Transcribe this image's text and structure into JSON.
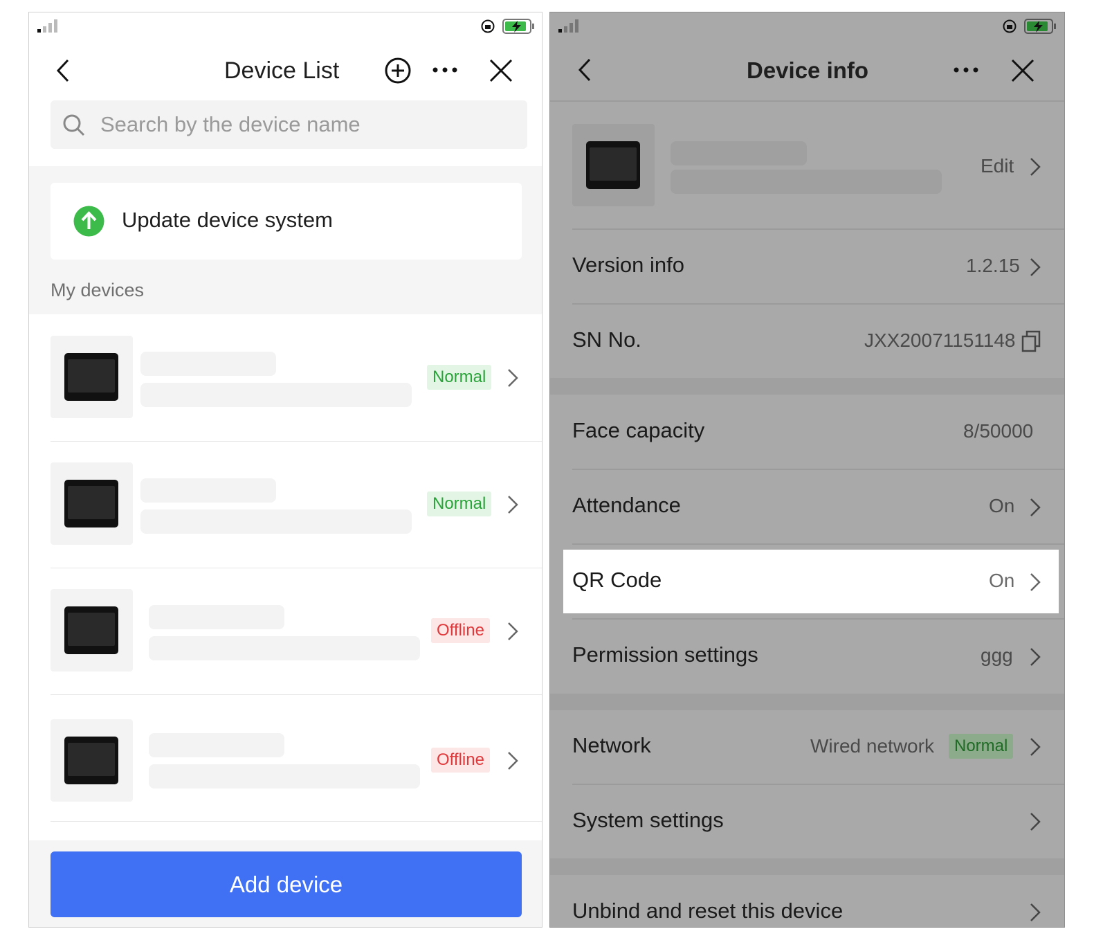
{
  "left": {
    "title": "Device List",
    "search_placeholder": "Search by the device name",
    "update_label": "Update device system",
    "section_label": "My devices",
    "devices": [
      {
        "status": "Normal"
      },
      {
        "status": "Normal"
      },
      {
        "status": "Offline"
      },
      {
        "status": "Offline"
      }
    ],
    "add_button": "Add device",
    "colors": {
      "accent": "#4070f4",
      "normal": "#2aa33a",
      "offline": "#e0393b",
      "update": "#3dbb4a"
    }
  },
  "right": {
    "title": "Device info",
    "edit_label": "Edit",
    "rows": {
      "version": {
        "label": "Version info",
        "value": "1.2.15"
      },
      "sn": {
        "label": "SN No.",
        "value": "JXX20071151148"
      },
      "face": {
        "label": "Face capacity",
        "value": "8/50000"
      },
      "attendance": {
        "label": "Attendance",
        "value": "On"
      },
      "qr": {
        "label": "QR Code",
        "value": "On"
      },
      "permission": {
        "label": "Permission settings",
        "value": "ggg"
      },
      "network": {
        "label": "Network",
        "value": "Wired network",
        "badge": "Normal"
      },
      "system": {
        "label": "System settings"
      },
      "unbind": {
        "label": "Unbind and reset this device"
      }
    }
  }
}
